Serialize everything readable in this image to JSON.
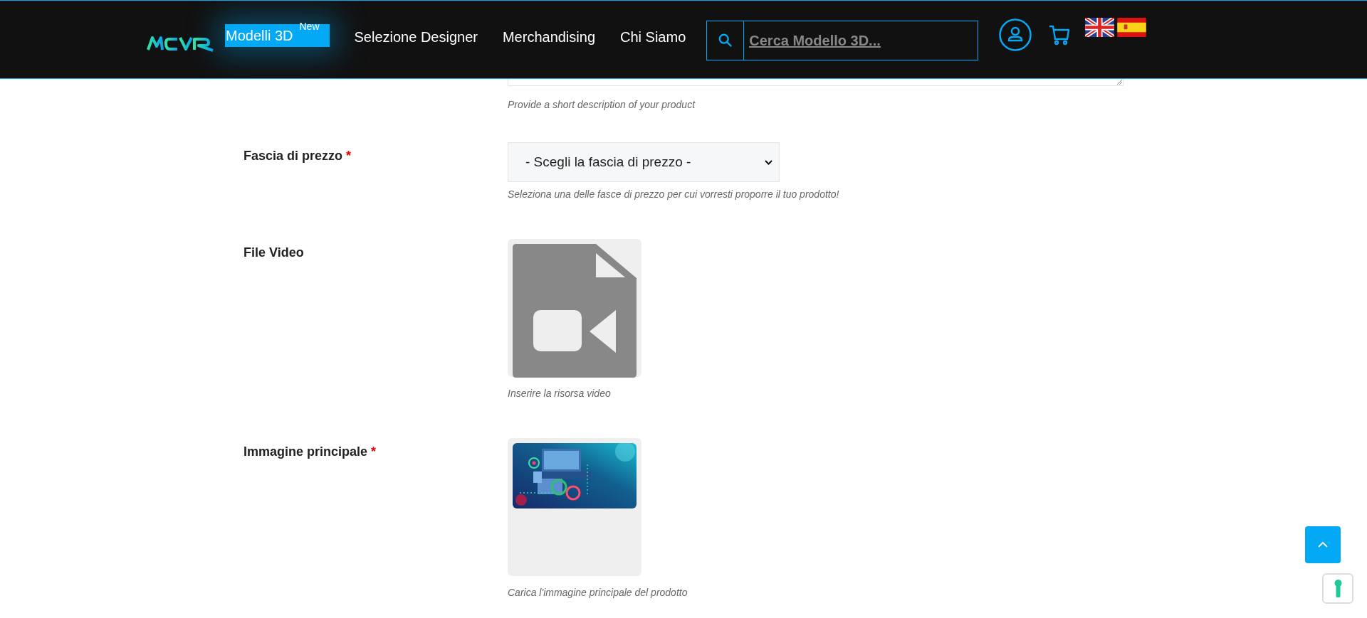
{
  "header": {
    "nav": [
      {
        "label": "Modelli 3D",
        "badge": "New",
        "selected": true
      },
      {
        "label": "Selezione Designer",
        "selected": false
      },
      {
        "label": "Merchandising",
        "selected": false
      },
      {
        "label": "Chi Siamo",
        "selected": false
      }
    ],
    "search": {
      "placeholder": "Cerca Modello 3D..."
    }
  },
  "fields": [
    {
      "kind": "textarea",
      "help": "Provide a short description of your product"
    },
    {
      "kind": "select",
      "label": "Fascia di prezzo",
      "required_mark": "*",
      "value": "- Scegli la fascia di prezzo -",
      "help": "Seleziona una delle fasce di prezzo per cui vorresti proporre il tuo prodotto!"
    },
    {
      "kind": "video",
      "label": "File Video",
      "help": "Inserire la risorsa video"
    },
    {
      "label": "Immagine principale",
      "required_mark": "*",
      "help": "Carica l'immagine principale del prodotto"
    }
  ]
}
